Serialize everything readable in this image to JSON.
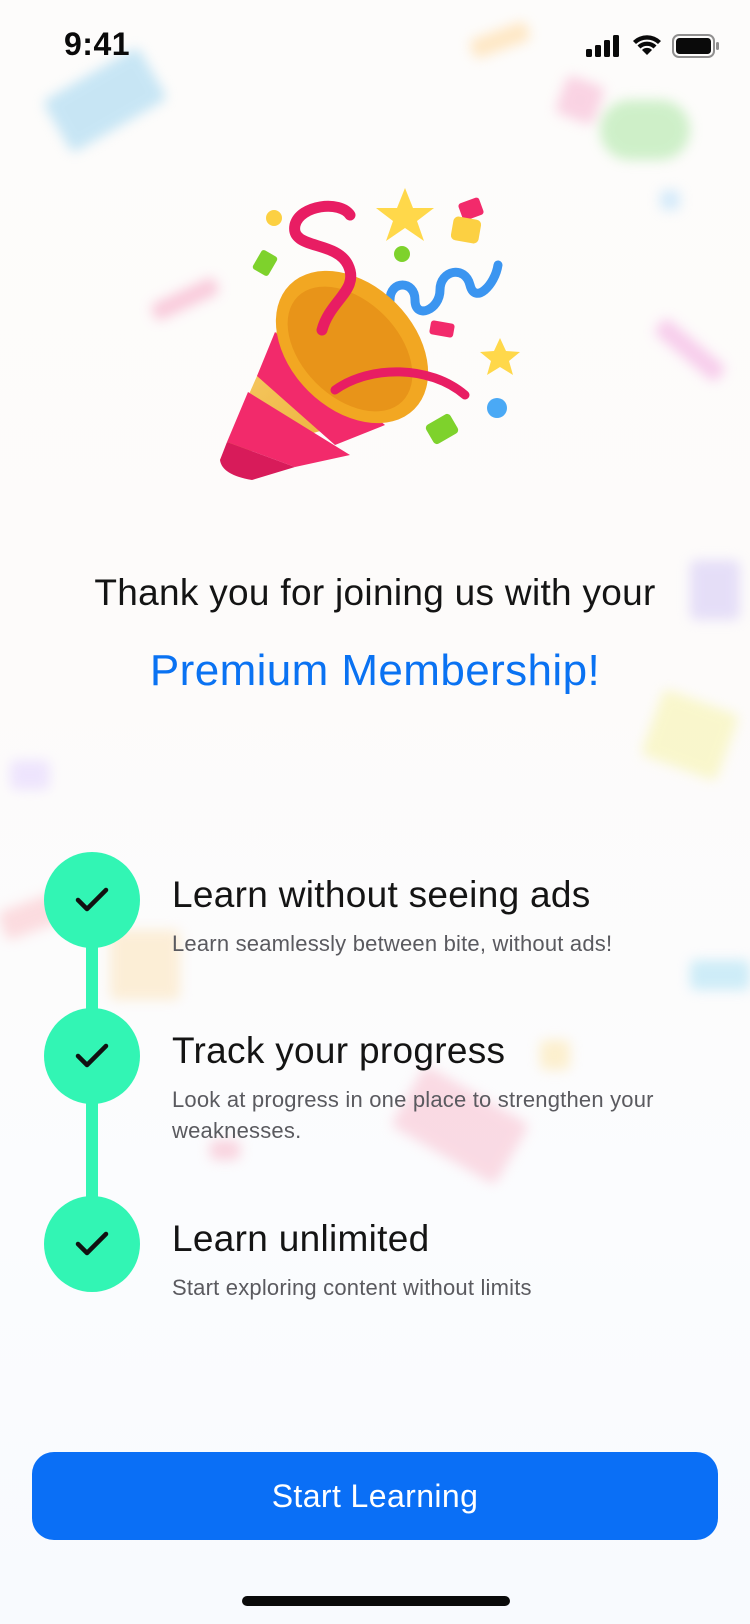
{
  "status_bar": {
    "time": "9:41",
    "icons": [
      "signal-icon",
      "wifi-icon",
      "battery-icon"
    ]
  },
  "illustration": {
    "icon": "party-popper-icon"
  },
  "headline": {
    "line1": "Thank you for joining us with your",
    "line2": "Premium Membership!"
  },
  "features": [
    {
      "title": "Learn without seeing ads",
      "description": "Learn seamlessly between bite, without ads!",
      "icon": "check-icon"
    },
    {
      "title": "Track your progress",
      "description": "Look at progress in one place to strengthen your weaknesses.",
      "icon": "check-icon"
    },
    {
      "title": "Learn unlimited",
      "description": "Start exploring content without limits",
      "icon": "check-icon"
    }
  ],
  "cta": {
    "label": "Start Learning"
  },
  "colors": {
    "accent": "#0a72f2",
    "button": "#0a6ff6",
    "check": "#32f5b4",
    "text": "#141414",
    "muted": "#5a5a5f"
  }
}
